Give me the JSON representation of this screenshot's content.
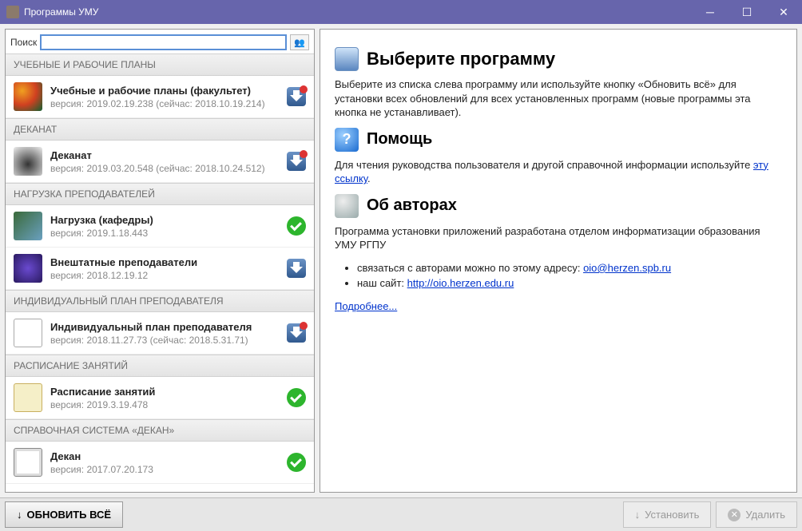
{
  "window": {
    "title": "Программы УМУ"
  },
  "search": {
    "label": "Поиск"
  },
  "groups": [
    {
      "header": "УЧЕБНЫЕ И РАБОЧИЕ ПЛАНЫ",
      "items": [
        {
          "name": "Учебные и рабочие планы (факультет)",
          "ver": "версия: 2019.02.19.238 (сейчас: 2018.10.19.214)",
          "thumb": "thumb-a",
          "status": "update"
        }
      ]
    },
    {
      "header": "ДЕКАНАТ",
      "items": [
        {
          "name": "Деканат",
          "ver": "версия: 2019.03.20.548 (сейчас: 2018.10.24.512)",
          "thumb": "thumb-b",
          "status": "update"
        }
      ]
    },
    {
      "header": "НАГРУЗКА ПРЕПОДАВАТЕЛЕЙ",
      "items": [
        {
          "name": "Нагрузка (кафедры)",
          "ver": "версия: 2019.1.18.443",
          "thumb": "thumb-c",
          "status": "ok"
        },
        {
          "name": "Внештатные преподаватели",
          "ver": "версия: 2018.12.19.12",
          "thumb": "thumb-d",
          "status": "download"
        }
      ]
    },
    {
      "header": "ИНДИВИДУАЛЬНЫЙ ПЛАН ПРЕПОДАВАТЕЛЯ",
      "items": [
        {
          "name": "Индивидуальный план преподавателя",
          "ver": "версия: 2018.11.27.73 (сейчас: 2018.5.31.71)",
          "thumb": "thumb-e",
          "status": "update"
        }
      ]
    },
    {
      "header": "РАСПИСАНИЕ ЗАНЯТИЙ",
      "items": [
        {
          "name": "Расписание занятий",
          "ver": "версия: 2019.3.19.478",
          "thumb": "thumb-f",
          "status": "ok"
        }
      ]
    },
    {
      "header": "СПРАВОЧНАЯ СИСТЕМА «ДЕКАН»",
      "items": [
        {
          "name": "Декан",
          "ver": "версия: 2017.07.20.173",
          "thumb": "thumb-g",
          "status": "ok"
        }
      ]
    }
  ],
  "right": {
    "h1": "Выберите программу",
    "p1": "Выберите из списка слева программу или используйте кнопку «Обновить всё» для установки всех обновлений для всех установленных программ (новые программы эта кнопка не устанавливает).",
    "h2": "Помощь",
    "p2_pre": "Для чтения руководства пользователя и другой справочной информации используйте ",
    "p2_link": "эту ссылку",
    "p2_post": ".",
    "h3": "Об авторах",
    "p3": "Программа установки приложений разработана отделом информатизации образования УМУ РГПУ",
    "li1_pre": "связаться с авторами можно по этому адресу: ",
    "li1_link": "oio@herzen.spb.ru",
    "li2_pre": "наш сайт: ",
    "li2_link": "http://oio.herzen.edu.ru",
    "more": "Подробнее..."
  },
  "footer": {
    "update_all": "ОБНОВИТЬ ВСЁ",
    "install": "Установить",
    "delete": "Удалить"
  }
}
